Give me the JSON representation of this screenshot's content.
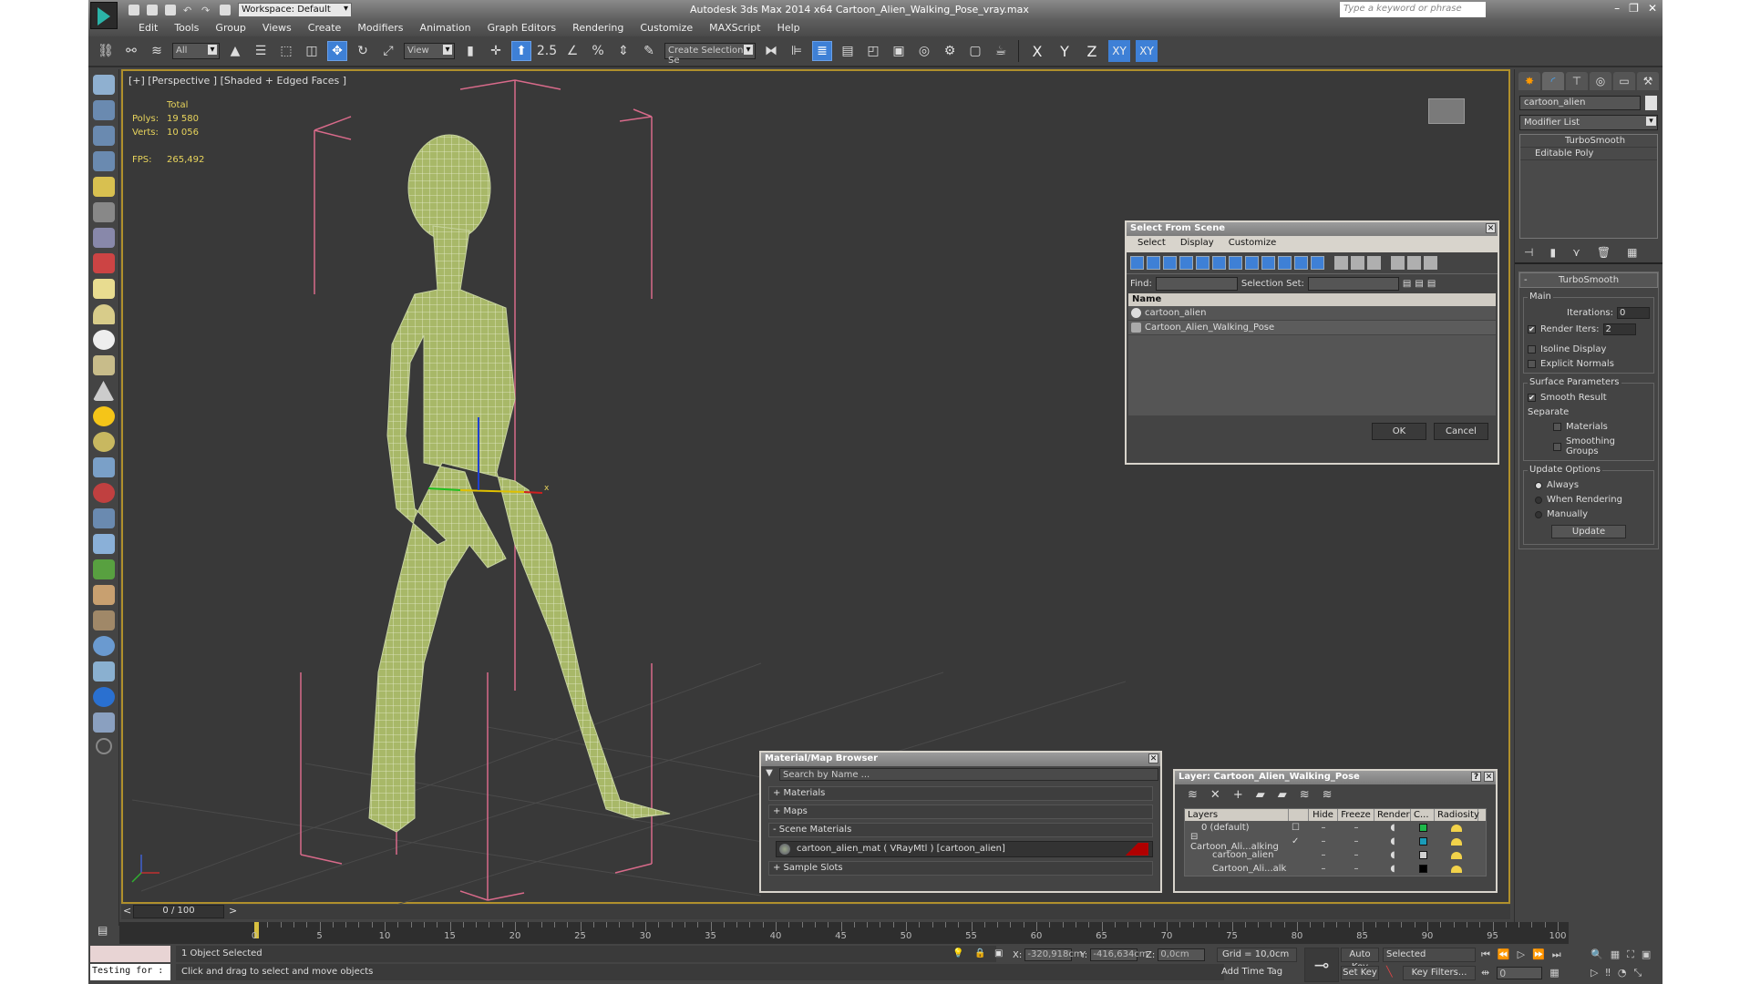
{
  "app": {
    "title": "Autodesk 3ds Max  2014 x64     Cartoon_Alien_Walking_Pose_vray.max",
    "workspace": "Workspace: Default",
    "search_placeholder": "Type a keyword or phrase"
  },
  "menu": [
    "Edit",
    "Tools",
    "Group",
    "Views",
    "Create",
    "Modifiers",
    "Animation",
    "Graph Editors",
    "Rendering",
    "Customize",
    "MAXScript",
    "Help"
  ],
  "toolbar": {
    "filter_value": "All",
    "ref_coord_value": "View",
    "snap_label": "2.5",
    "named_selection_placeholder": "Create Selection Se",
    "axis": [
      "X",
      "Y",
      "Z",
      "XY",
      "XY"
    ]
  },
  "viewport": {
    "label": "[+] [Perspective ] [Shaded + Edged Faces ]",
    "stats": {
      "total_label": "Total",
      "polys_label": "Polys:",
      "polys": "19 580",
      "verts_label": "Verts:",
      "verts": "10 056",
      "fps_label": "FPS:",
      "fps": "265,492"
    }
  },
  "command_panel": {
    "object_name": "cartoon_alien",
    "modifier_list": "Modifier List",
    "stack": [
      "TurboSmooth",
      "Editable Poly"
    ],
    "turbosmooth": {
      "title": "TurboSmooth",
      "main_label": "Main",
      "iterations_label": "Iterations:",
      "iterations": "0",
      "render_iters_label": "Render Iters:",
      "render_iters": "2",
      "render_iters_checked": true,
      "isoline_label": "Isoline Display",
      "explicit_normals_label": "Explicit Normals",
      "surface_label": "Surface Parameters",
      "smooth_result_label": "Smooth Result",
      "separate_label": "Separate",
      "materials_label": "Materials",
      "smoothing_groups_label": "Smoothing Groups",
      "update_options_label": "Update Options",
      "always_label": "Always",
      "when_rendering_label": "When Rendering",
      "manually_label": "Manually",
      "update_button": "Update"
    }
  },
  "select_from_scene": {
    "title": "Select From Scene",
    "menu": [
      "Select",
      "Display",
      "Customize"
    ],
    "find_label": "Find:",
    "selection_set_label": "Selection Set:",
    "column_name": "Name",
    "items": [
      "cartoon_alien",
      "Cartoon_Alien_Walking_Pose"
    ],
    "ok": "OK",
    "cancel": "Cancel"
  },
  "material_browser": {
    "title": "Material/Map Browser",
    "search_placeholder": "Search by Name ...",
    "sections": [
      "+ Materials",
      "+ Maps",
      "- Scene Materials",
      "+ Sample Slots"
    ],
    "scene_material": "cartoon_alien_mat  ( VRayMtl ) [cartoon_alien]"
  },
  "layer_manager": {
    "title": "Layer: Cartoon_Alien_Walking_Pose",
    "columns": [
      "Layers",
      "",
      "Hide",
      "Freeze",
      "Render",
      "C...",
      "Radiosity"
    ],
    "rows": [
      {
        "name": "0 (default)",
        "color": "#1db84a",
        "current": "box"
      },
      {
        "name": "Cartoon_Ali...alking",
        "color": "#1a9bb8",
        "current": "check"
      },
      {
        "name": "cartoon_alien",
        "color": "#d0d0d0",
        "current": ""
      },
      {
        "name": "Cartoon_Ali...alk",
        "color": "#000000",
        "current": ""
      }
    ]
  },
  "timeline": {
    "frame_display": "0 / 100",
    "ticks": [
      "0",
      "5",
      "10",
      "15",
      "20",
      "25",
      "30",
      "35",
      "40",
      "45",
      "50",
      "55",
      "60",
      "65",
      "70",
      "75",
      "80",
      "85",
      "90",
      "95",
      "100"
    ]
  },
  "status": {
    "selection": "1 Object Selected",
    "prompt": "Click and drag to select and move objects",
    "maxscript": "Testing for :",
    "x_label": "X:",
    "x": "-320,918cm",
    "y_label": "Y:",
    "y": "-416,634cm",
    "z_label": "Z:",
    "z": "0,0cm",
    "grid": "Grid = 10,0cm",
    "add_time_tag": "Add Time Tag",
    "auto_key": "Auto Key",
    "set_key": "Set Key",
    "key_mode": "Selected",
    "key_filters": "Key Filters...",
    "current_frame": "0"
  },
  "colors": {
    "accent": "#3e80d6",
    "viewport_border": "#b0902c",
    "stats_text": "#e8d45c",
    "mesh": "#a8b868"
  }
}
